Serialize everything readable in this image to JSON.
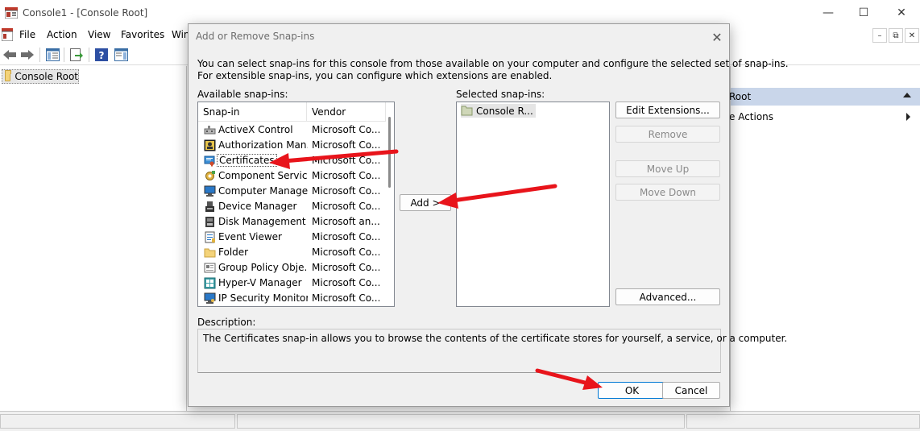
{
  "window": {
    "title": "Console1 - [Console Root]",
    "minimize": "—",
    "maximize": "☐",
    "close": "✕"
  },
  "menu": {
    "items": [
      "File",
      "Action",
      "View",
      "Favorites",
      "Win"
    ],
    "mdi_min": "–",
    "mdi_restore": "⧉",
    "mdi_close": "✕"
  },
  "tree": {
    "root_label": "Console Root"
  },
  "actions_pane": {
    "header": "Root",
    "more_actions": "e Actions"
  },
  "dialog": {
    "title": "Add or Remove Snap-ins",
    "close": "✕",
    "intro_line1": "You can select snap-ins for this console from those available on your computer and configure the selected set of snap-ins.",
    "intro_line2": "For extensible snap-ins, you can configure which extensions are enabled.",
    "available_label": "Available snap-ins:",
    "selected_label": "Selected snap-ins:",
    "columns": {
      "snapin": "Snap-in",
      "vendor": "Vendor"
    },
    "snapins": [
      {
        "name": "ActiveX Control",
        "vendor": "Microsoft Co...",
        "icon": "activex-icon"
      },
      {
        "name": "Authorization Man...",
        "vendor": "Microsoft Co...",
        "icon": "authorization-icon"
      },
      {
        "name": "Certificates",
        "vendor": "Microsoft Co...",
        "icon": "certificates-icon",
        "selected": true
      },
      {
        "name": "Component Services",
        "vendor": "Microsoft Co...",
        "icon": "component-services-icon"
      },
      {
        "name": "Computer Manage...",
        "vendor": "Microsoft Co...",
        "icon": "computer-management-icon"
      },
      {
        "name": "Device Manager",
        "vendor": "Microsoft Co...",
        "icon": "device-manager-icon"
      },
      {
        "name": "Disk Management",
        "vendor": "Microsoft an...",
        "icon": "disk-management-icon"
      },
      {
        "name": "Event Viewer",
        "vendor": "Microsoft Co...",
        "icon": "event-viewer-icon"
      },
      {
        "name": "Folder",
        "vendor": "Microsoft Co...",
        "icon": "folder-icon"
      },
      {
        "name": "Group Policy Obje...",
        "vendor": "Microsoft Co...",
        "icon": "group-policy-icon"
      },
      {
        "name": "Hyper-V Manager",
        "vendor": "Microsoft Co...",
        "icon": "hyperv-icon"
      },
      {
        "name": "IP Security Monitor",
        "vendor": "Microsoft Co...",
        "icon": "ip-security-icon"
      }
    ],
    "add_button": "Add >",
    "selected_item": "Console R...",
    "buttons": {
      "edit_extensions": "Edit Extensions...",
      "remove": "Remove",
      "move_up": "Move Up",
      "move_down": "Move Down",
      "advanced": "Advanced...",
      "ok": "OK",
      "cancel": "Cancel"
    },
    "description_label": "Description:",
    "description_text": "The Certificates snap-in allows you to browse the contents of the certificate stores for yourself, a service, or a computer."
  },
  "colors": {
    "annotation_arrow": "#e8141b",
    "dialog_bg": "#f0f0f0",
    "actions_header_bg": "#c9d6ea",
    "ok_border": "#0078d4"
  }
}
